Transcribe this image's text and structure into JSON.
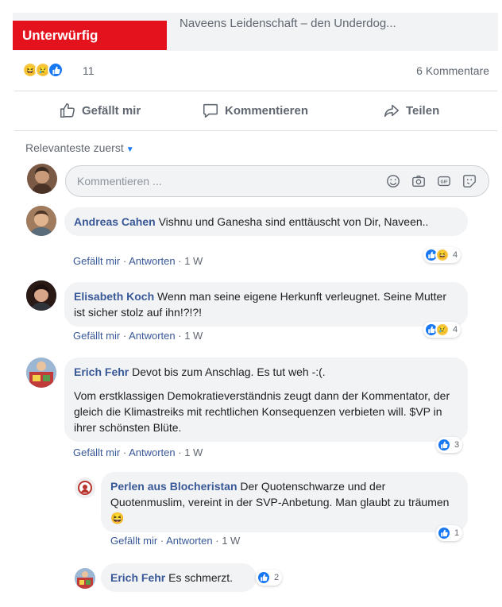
{
  "preview": {
    "label": "Unterwürfig",
    "title": "Naveens Leidenschaft – den Underdog..."
  },
  "summary": {
    "reactions": [
      "haha-icon",
      "sad-icon",
      "like-icon"
    ],
    "count": "11",
    "comments": "6 Kommentare"
  },
  "actions": {
    "like": "Gefällt mir",
    "comment": "Kommentieren",
    "share": "Teilen"
  },
  "sort": {
    "label": "Relevanteste zuerst"
  },
  "input": {
    "placeholder": "Kommentieren ..."
  },
  "colors": {
    "link": "#385898",
    "like_blue": "#1877f2",
    "red": "#e4121d",
    "bubble": "#f2f3f5"
  },
  "comments": [
    {
      "author": "Andreas Cahen",
      "text": "Vishnu und Ganesha sind enttäuscht von Dir, Naveen..",
      "like": "Gefällt mir",
      "reply": "Antworten",
      "time": "1 W",
      "reactions": [
        "like-icon",
        "haha-icon"
      ],
      "reaction_count": "4"
    },
    {
      "author": "Elisabeth Koch",
      "text": "Wenn man seine eigene Herkunft verleugnet. Seine Mutter ist sicher stolz auf ihn!?!?!",
      "like": "Gefällt mir",
      "reply": "Antworten",
      "time": "1 W",
      "reactions": [
        "like-icon",
        "sad-icon"
      ],
      "reaction_count": "4"
    },
    {
      "author": "Erich Fehr",
      "text": "Devot bis zum Anschlag. Es tut weh -:(.",
      "text2": "Vom erstklassigen Demokratieverständnis zeugt dann der Kommentator, der gleich die Klimastreiks mit rechtlichen Konsequenzen verbieten will. $VP in ihrer schönsten Blüte.",
      "like": "Gefällt mir",
      "reply": "Antworten",
      "time": "1 W",
      "reactions": [
        "like-icon"
      ],
      "reaction_count": "3"
    }
  ],
  "replies": [
    {
      "author": "Perlen aus Blocheristan",
      "text": "Der Quotenschwarze und der Quotenmuslim, vereint in der SVP-Anbetung. Man glaubt zu träumen",
      "emoji": "😆",
      "like": "Gefällt mir",
      "reply": "Antworten",
      "time": "1 W",
      "reactions": [
        "like-icon"
      ],
      "reaction_count": "1"
    },
    {
      "author": "Erich Fehr",
      "text": "Es schmerzt.",
      "reactions": [
        "like-icon"
      ],
      "reaction_count": "2"
    }
  ],
  "sep": " · "
}
